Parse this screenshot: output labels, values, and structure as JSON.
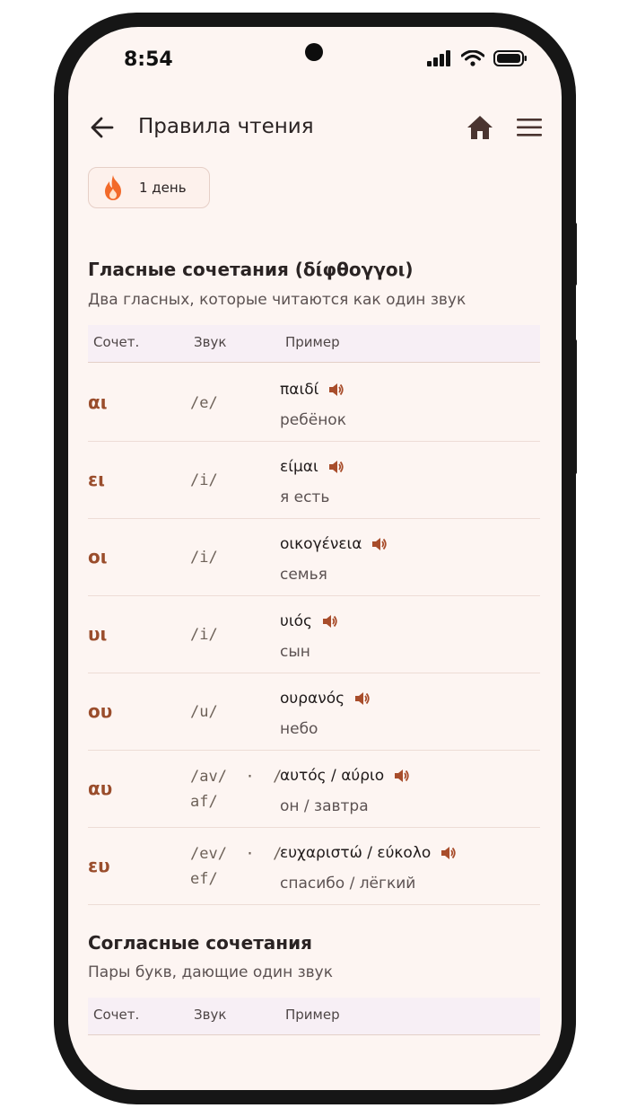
{
  "status": {
    "time": "8:54"
  },
  "appbar": {
    "title": "Правила чтения"
  },
  "streak": {
    "label": "1 день"
  },
  "table_headers": {
    "combo": "Сочет.",
    "sound": "Звук",
    "example": "Пример"
  },
  "vowels": {
    "title": "Гласные сочетания (δίφθογγοι)",
    "subtitle": "Два гласных, которые читаются как один звук",
    "rows": [
      {
        "combo": "αι",
        "sound": "/e/",
        "word": "παιδί",
        "translation": "ребёнок"
      },
      {
        "combo": "ει",
        "sound": "/i/",
        "word": "είμαι",
        "translation": "я есть"
      },
      {
        "combo": "οι",
        "sound": "/i/",
        "word": "οικογένεια",
        "translation": "семья"
      },
      {
        "combo": "υι",
        "sound": "/i/",
        "word": "υιός",
        "translation": "сын"
      },
      {
        "combo": "ου",
        "sound": "/u/",
        "word": "ουρανός",
        "translation": "небо"
      },
      {
        "combo": "αυ",
        "sound": "/av/  ·  /\naf/",
        "word": "αυτός / αύριο",
        "translation": "он / завтра"
      },
      {
        "combo": "ευ",
        "sound": "/ev/  ·  /\nef/",
        "word": "ευχαριστώ / εύκολο",
        "translation": "спасибо / лёгкий"
      }
    ]
  },
  "consonants": {
    "title": "Согласные сочетания",
    "subtitle": "Пары букв, дающие один звук"
  },
  "colors": {
    "accent": "#9a4d2c",
    "background": "#fdf5f2",
    "header_bg": "#f7eff5"
  }
}
